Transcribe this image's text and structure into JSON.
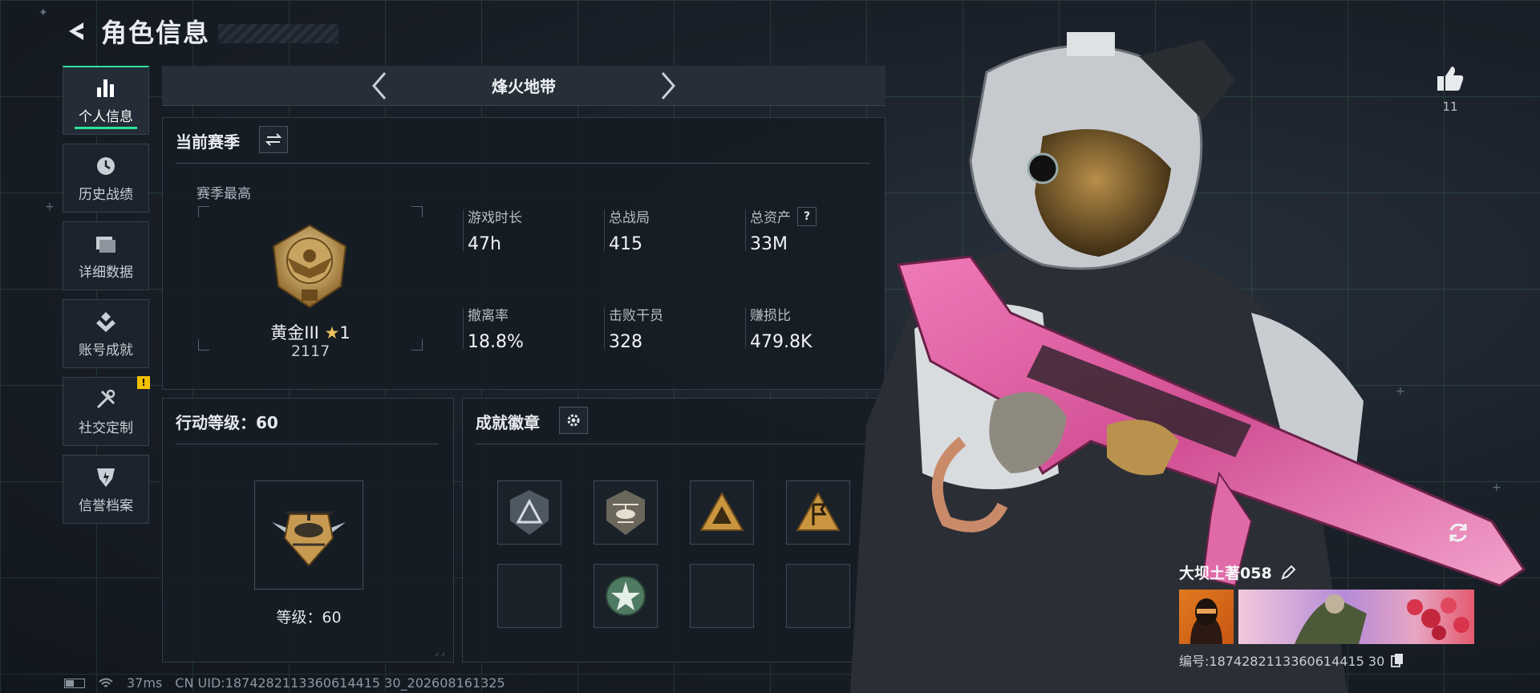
{
  "header": {
    "title": "角色信息"
  },
  "sidebar": {
    "items": [
      {
        "label": "个人信息",
        "icon": "bar-chart-icon",
        "active": true
      },
      {
        "label": "历史战绩",
        "icon": "clock-icon",
        "active": false
      },
      {
        "label": "详细数据",
        "icon": "folder-icon",
        "active": false
      },
      {
        "label": "账号成就",
        "icon": "achievement-icon",
        "active": false
      },
      {
        "label": "社交定制",
        "icon": "tools-icon",
        "active": false,
        "badge": "!"
      },
      {
        "label": "信誉档案",
        "icon": "shield-icon",
        "active": false
      }
    ]
  },
  "mode": {
    "label": "烽火地带"
  },
  "season": {
    "title": "当前赛季",
    "best_label": "赛季最高",
    "rank_name": "黄金III",
    "rank_stars": "1",
    "rank_score": "2117",
    "stats": [
      {
        "label": "游戏时长",
        "value": "47h"
      },
      {
        "label": "总战局",
        "value": "415"
      },
      {
        "label": "总资产",
        "value": "33M",
        "help": "?"
      },
      {
        "label": "撤离率",
        "value": "18.8%"
      },
      {
        "label": "击败干员",
        "value": "328"
      },
      {
        "label": "赚损比",
        "value": "479.8K"
      }
    ]
  },
  "level": {
    "title": "行动等级：60",
    "caption": "等级：60"
  },
  "badges": {
    "title": "成就徽章",
    "slots": [
      {
        "icon": "triangle-badge-icon",
        "filled": true
      },
      {
        "icon": "helicopter-badge-icon",
        "filled": true
      },
      {
        "icon": "gold-triangle-badge-icon",
        "filled": true
      },
      {
        "icon": "flag-badge-icon",
        "filled": true
      },
      {
        "icon": "",
        "filled": false
      },
      {
        "icon": "star-badge-icon",
        "filled": true
      },
      {
        "icon": "",
        "filled": false
      },
      {
        "icon": "",
        "filled": false
      }
    ]
  },
  "footer": {
    "ping": "37ms",
    "uid": "CN UID:1874282113360614415 30_202608161325"
  },
  "likes": {
    "count": "11"
  },
  "player": {
    "name": "大坝土著058",
    "id": "编号:1874282113360614415 30"
  },
  "colors": {
    "accent": "#2ee29a",
    "alert": "#f2c200",
    "gold": "#e9c25a"
  }
}
